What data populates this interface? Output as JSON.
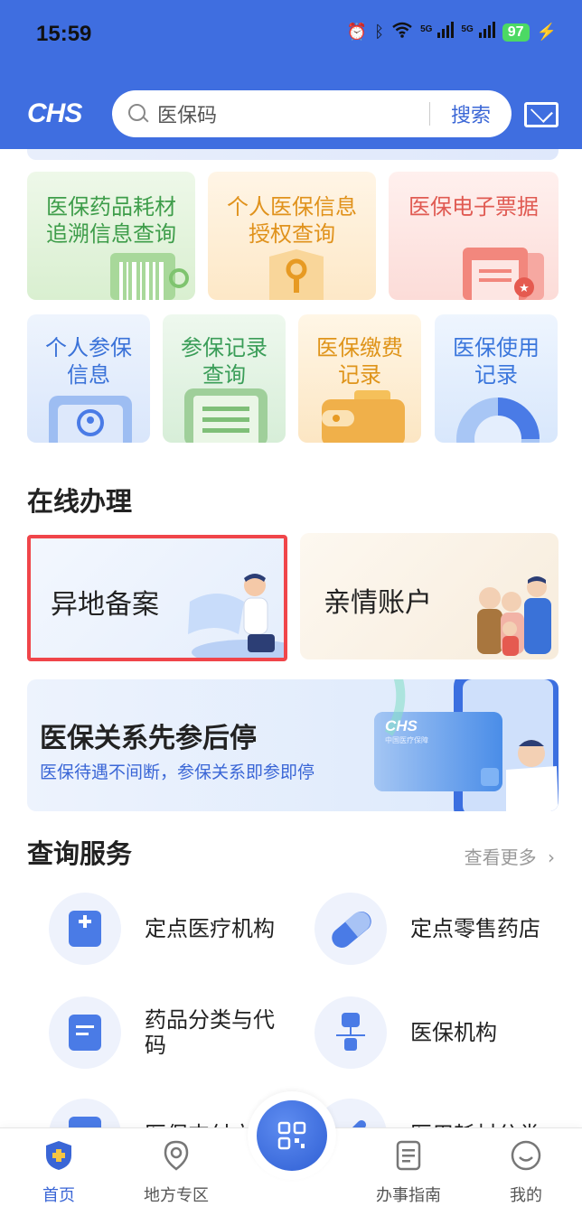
{
  "status_bar": {
    "time": "15:59",
    "tag_5g_1": "5G",
    "tag_5g_2": "5G",
    "battery": "97"
  },
  "header": {
    "logo": "CHS",
    "search_placeholder": "医保码",
    "search_button": "搜索"
  },
  "tiles_row1": [
    {
      "label1": "医保药品耗材",
      "label2": "追溯信息查询"
    },
    {
      "label1": "个人医保信息",
      "label2": "授权查询"
    },
    {
      "label1": "医保电子票据",
      "label2": ""
    }
  ],
  "tiles_row2": [
    {
      "label1": "个人参保",
      "label2": "信息"
    },
    {
      "label1": "参保记录",
      "label2": "查询"
    },
    {
      "label1": "医保缴费",
      "label2": "记录"
    },
    {
      "label1": "医保使用",
      "label2": "记录"
    }
  ],
  "online": {
    "title": "在线办理",
    "card1": "异地备案",
    "card2": "亲情账户"
  },
  "promo": {
    "title": "医保关系先参后停",
    "subtitle": "医保待遇不间断，参保关系即参即停",
    "card_logo": "CHS",
    "card_text": "中国医疗保障"
  },
  "query": {
    "title": "查询服务",
    "more": "查看更多",
    "items": [
      {
        "label": "定点医疗机构"
      },
      {
        "label": "定点零售药店"
      },
      {
        "label": "药品分类与代码"
      },
      {
        "label": "医保机构"
      },
      {
        "label": "医保支付方式"
      },
      {
        "label": "医用耗材分类"
      }
    ]
  },
  "bottom_nav": {
    "items": [
      {
        "label": "首页"
      },
      {
        "label": "地方专区"
      },
      {
        "label": "办事指南"
      },
      {
        "label": "我的"
      }
    ]
  },
  "colors": {
    "header_blue": "#3f6ee0",
    "accent_blue": "#3a66d6",
    "highlight_red": "#f0454a"
  }
}
